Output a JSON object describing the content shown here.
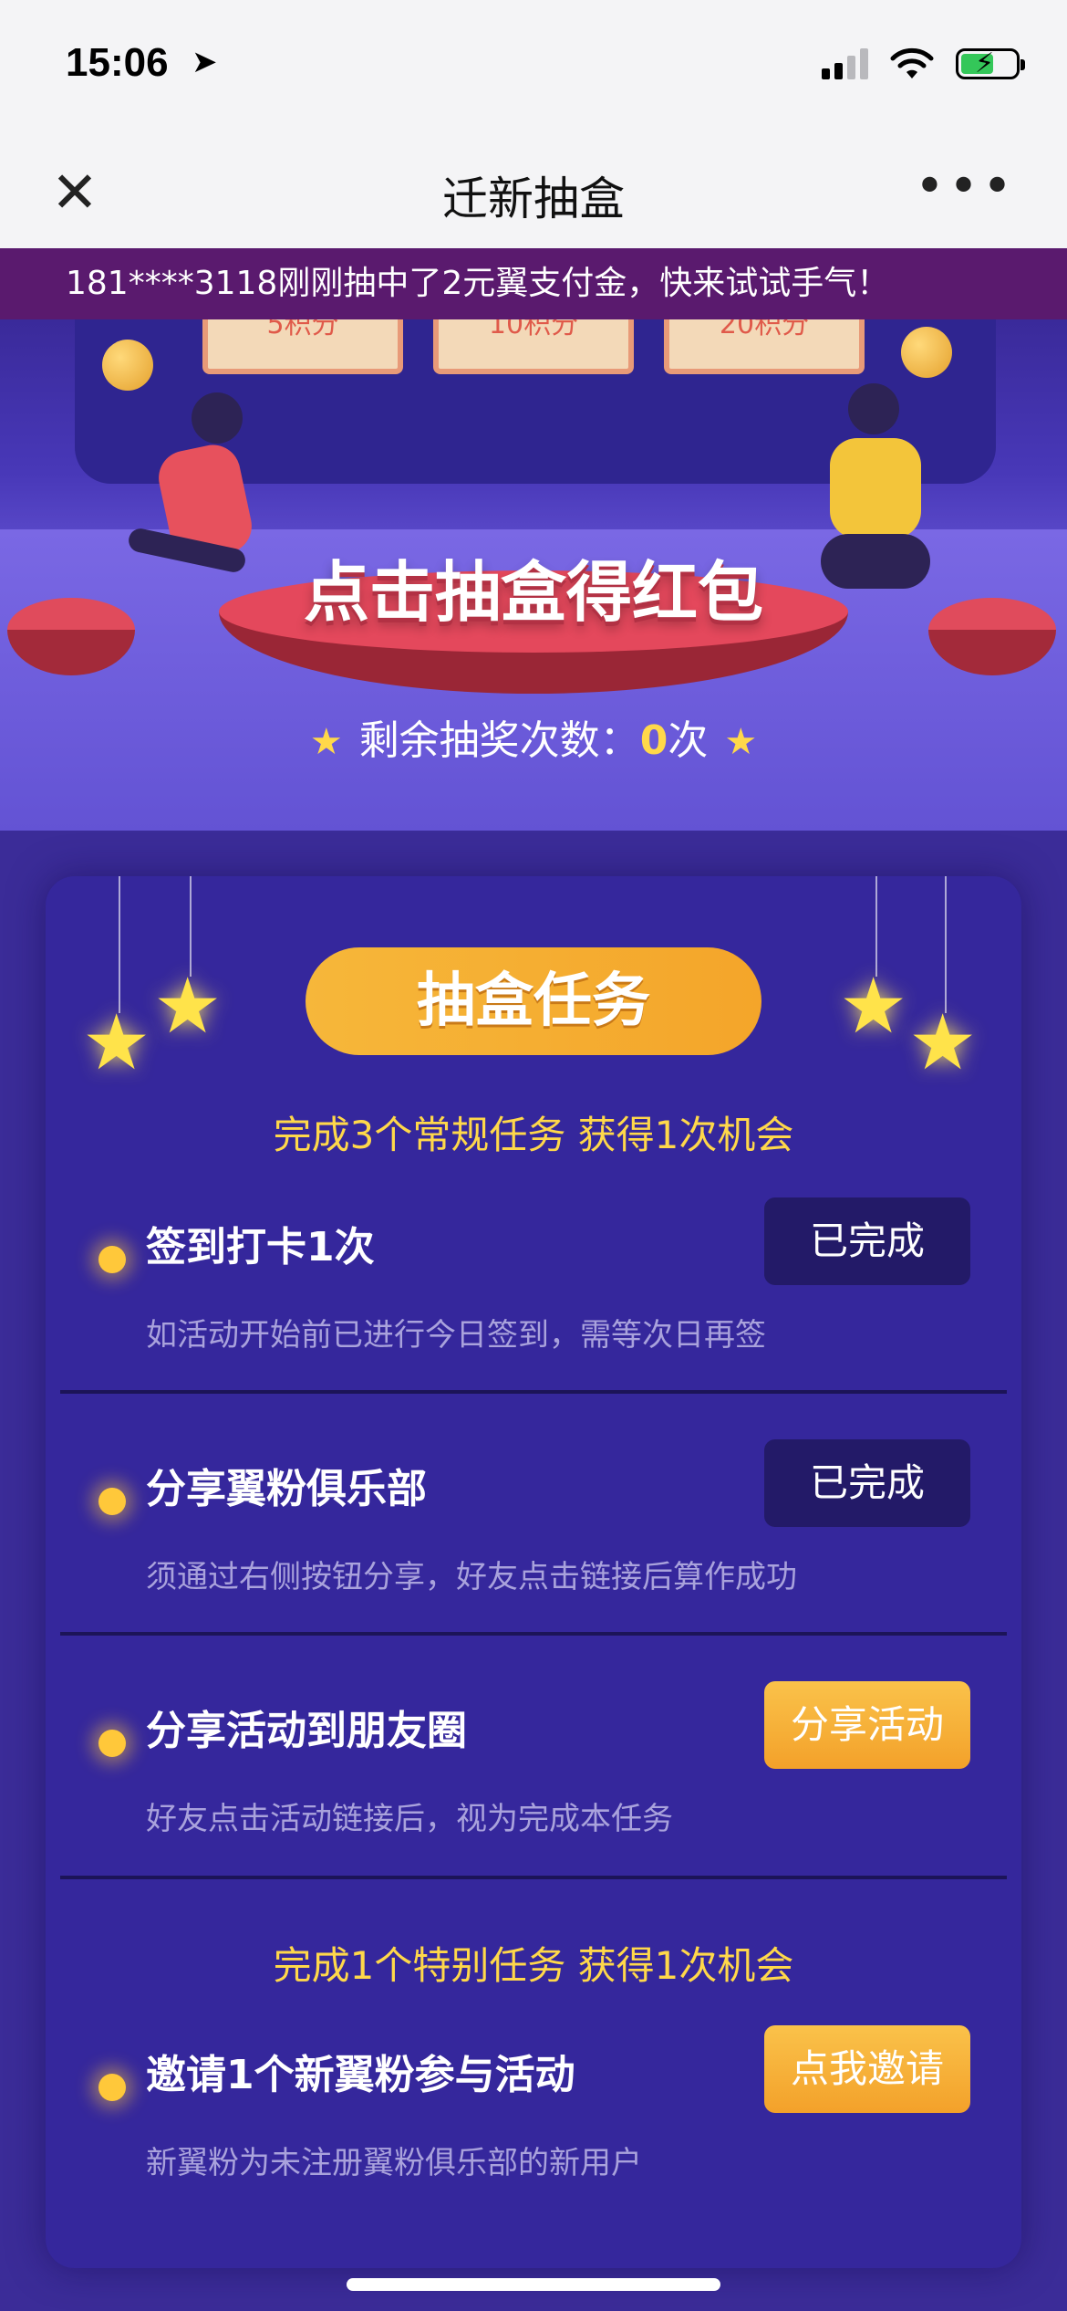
{
  "status_bar": {
    "time": "15:06"
  },
  "nav": {
    "title": "迁新抽盒"
  },
  "ticker": {
    "text": "181****3118刚刚抽中了2元翼支付金，快来试试手气！"
  },
  "stage": {
    "prizes": [
      "5积分",
      "10积分",
      "20积分"
    ],
    "headline": "点击抽盒得红包",
    "remaining_label": "剩余抽奖次数：",
    "remaining_count": "0",
    "remaining_unit": "次"
  },
  "panel": {
    "title": "抽盒任务",
    "regular_heading": "完成3个常规任务 获得1次机会",
    "special_heading": "完成1个特别任务 获得1次机会",
    "tasks": [
      {
        "title": "签到打卡1次",
        "desc": "如活动开始前已进行今日签到，需等次日再签",
        "button": "已完成",
        "state": "done"
      },
      {
        "title": "分享翼粉俱乐部",
        "desc": "须通过右侧按钮分享，好友点击链接后算作成功",
        "button": "已完成",
        "state": "done"
      },
      {
        "title": "分享活动到朋友圈",
        "desc": "好友点击活动链接后，视为完成本任务",
        "button": "分享活动",
        "state": "action"
      },
      {
        "title": "邀请1个新翼粉参与活动",
        "desc": "新翼粉为未注册翼粉俱乐部的新用户",
        "button": "点我邀请",
        "state": "action"
      }
    ]
  },
  "colors": {
    "background": "#3b2c98",
    "panel": "#35279c",
    "accent_yellow": "#ffd84a",
    "button_orange": "#f3a12a",
    "button_done": "#231a68"
  }
}
